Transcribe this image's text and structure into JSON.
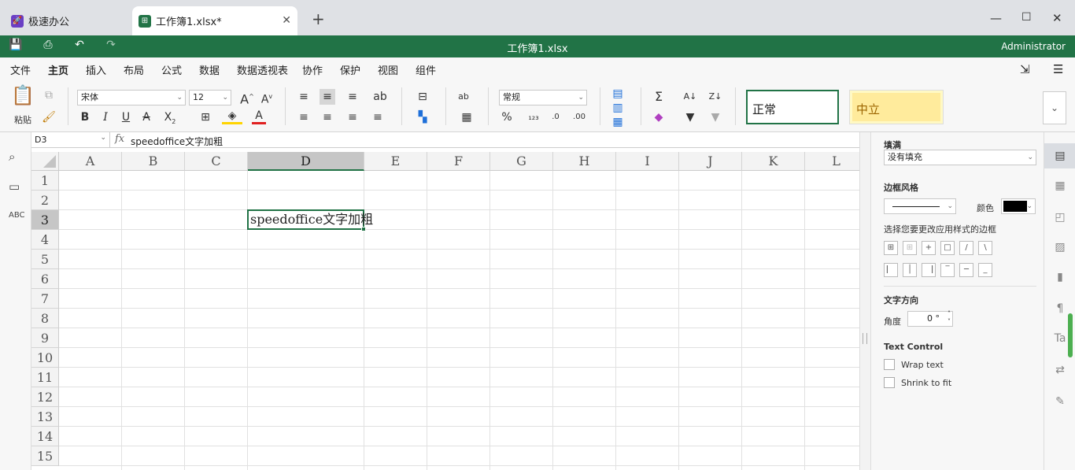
{
  "tabs": {
    "home": "极速办公",
    "doc": "工作簿1.xlsx*",
    "new": "+"
  },
  "window": {
    "min": "—",
    "max": "☐",
    "close": "✕"
  },
  "titlebar": {
    "title": "工作簿1.xlsx",
    "user": "Administrator"
  },
  "menu": {
    "items": [
      "文件",
      "主页",
      "插入",
      "布局",
      "公式",
      "数据",
      "数据透视表",
      "协作",
      "保护",
      "视图",
      "组件"
    ],
    "active": "主页"
  },
  "ribbon": {
    "paste": "粘贴",
    "font_name": "宋体",
    "font_size": "12",
    "number_format": "常规",
    "style_normal": "正常",
    "style_neutral": "中立"
  },
  "formula_bar": {
    "cell_ref": "D3",
    "fx": "fx",
    "value": "speedoffice文字加粗"
  },
  "sheet": {
    "columns": [
      "A",
      "B",
      "C",
      "D",
      "E",
      "F",
      "G",
      "H",
      "I",
      "J",
      "K",
      "L"
    ],
    "rows": [
      "1",
      "2",
      "3",
      "4",
      "5",
      "6",
      "7",
      "8",
      "9",
      "10",
      "11",
      "12",
      "13",
      "14",
      "15"
    ],
    "selected_col": "D",
    "selected_row": "3",
    "cell_D3": "speedoffice文字加粗"
  },
  "panel": {
    "fill_title": "填满",
    "fill_value": "没有填充",
    "border_title": "边框风格",
    "color_label": "颜色",
    "border_hint": "选择您要更改应用样式的边框",
    "text_dir_title": "文字方向",
    "angle_label": "角度",
    "angle_value": "0 °",
    "text_control_title": "Text Control",
    "wrap_text": "Wrap text",
    "shrink_to_fit": "Shrink to fit"
  },
  "colors": {
    "brand": "#217346",
    "neutral_bg": "#ffeb9c",
    "neutral_text": "#9c6500",
    "font_color": "#e02020",
    "fill_color": "#ffd400"
  }
}
